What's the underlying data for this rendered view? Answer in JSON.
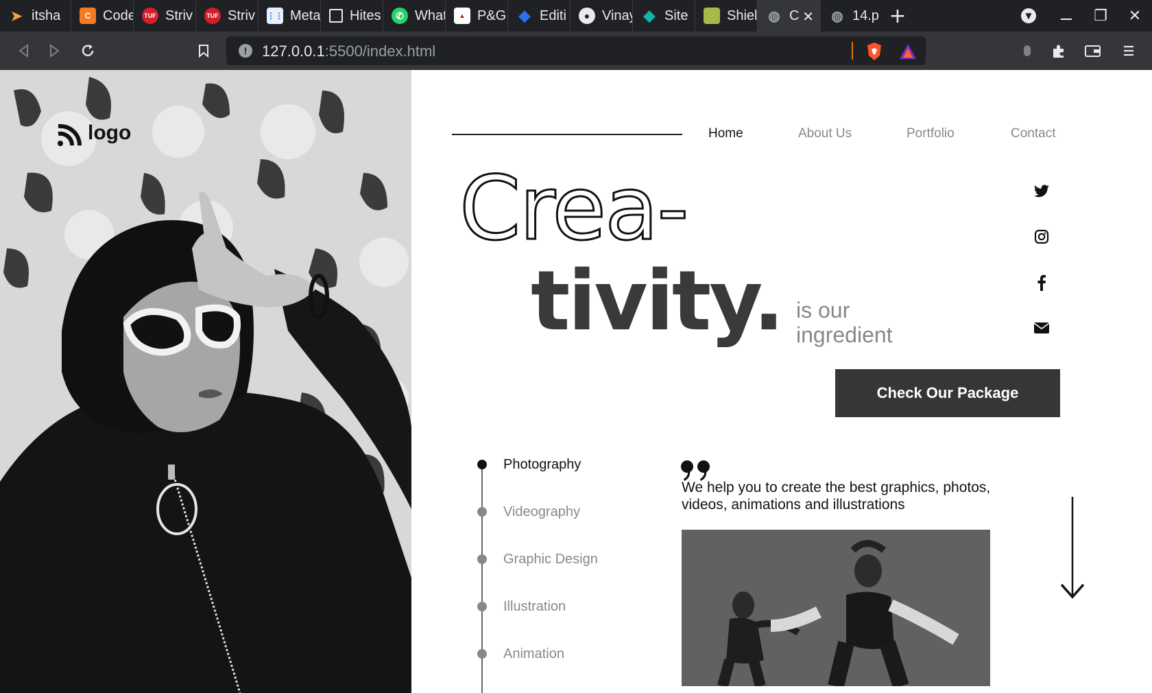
{
  "browser": {
    "tabs": [
      {
        "label": "itsha",
        "icon": "itsha-favicon"
      },
      {
        "label": "Code",
        "icon": "codepen-orange-favicon"
      },
      {
        "label": "Striv",
        "icon": "tuf-favicon"
      },
      {
        "label": "Striv",
        "icon": "tuf-favicon"
      },
      {
        "label": "Meta",
        "icon": "meta-grid-favicon"
      },
      {
        "label": "Hites",
        "icon": "square-outline-favicon"
      },
      {
        "label": "What",
        "icon": "whatsapp-favicon"
      },
      {
        "label": "P&G",
        "icon": "pg-favicon"
      },
      {
        "label": "Editi",
        "icon": "blue-diamond-favicon"
      },
      {
        "label": "Vinay",
        "icon": "github-favicon"
      },
      {
        "label": "Site",
        "icon": "teal-diamond-favicon"
      },
      {
        "label": "Shiel",
        "icon": "shield-favicon"
      },
      {
        "label": "C",
        "icon": "globe-favicon",
        "active": true
      },
      {
        "label": "14.p",
        "icon": "globe-favicon"
      }
    ],
    "url_host": "127.0.0.1",
    "url_rest": ":5500/index.html"
  },
  "site": {
    "logo_text": "logo",
    "nav": [
      "Home",
      "About Us",
      "Portfolio",
      "Contact"
    ],
    "hero_outline": "Crea-",
    "hero_solid": "tivity.",
    "hero_tagline_line1": "is our",
    "hero_tagline_line2": "ingredient",
    "cta_label": "Check Our Package",
    "services": [
      "Photography",
      "Videography",
      "Graphic Design",
      "Illustration",
      "Animation"
    ],
    "quote_mark": "99",
    "quote_text": "We help you to create the best graphics, photos, videos, animations and illustrations",
    "social": [
      "twitter-icon",
      "instagram-icon",
      "facebook-icon",
      "mail-icon"
    ]
  },
  "colors": {
    "chrome_dark": "#202124",
    "chrome_mid": "#35363a",
    "cta_bg": "#363636",
    "text_muted": "#888888",
    "text_dark": "#111111"
  }
}
